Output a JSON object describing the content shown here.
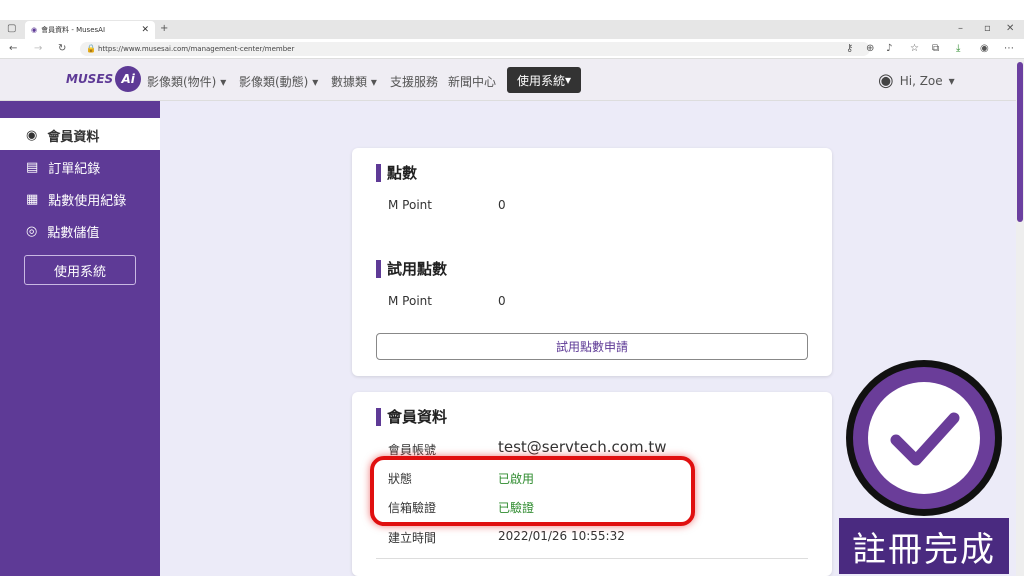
{
  "browser": {
    "tab_title": "會員資料 - MusesAI",
    "url": "https://www.musesai.com/management-center/member"
  },
  "nav": {
    "logo_text": "MUSES",
    "logo_badge": "Ai",
    "items": [
      "影像類(物件)",
      "影像類(動態)",
      "數據類",
      "支援服務",
      "新聞中心"
    ],
    "system_button": "使用系統",
    "user_greeting": "Hi, Zoe"
  },
  "sidebar": {
    "items": [
      "會員資料",
      "訂單紀錄",
      "點數使用紀錄",
      "點數儲值"
    ],
    "system_button": "使用系統"
  },
  "points": {
    "title": "點數",
    "label": "M Point",
    "value": "0"
  },
  "trial_points": {
    "title": "試用點數",
    "label": "M Point",
    "value": "0",
    "apply_button": "試用點數申請"
  },
  "member": {
    "title": "會員資料",
    "rows": [
      {
        "label": "會員帳號",
        "value": "test@servtech.com.tw"
      },
      {
        "label": "狀態",
        "value": "已啟用"
      },
      {
        "label": "信箱驗證",
        "value": "已驗證"
      },
      {
        "label": "建立時間",
        "value": "2022/01/26 10:55:32"
      }
    ]
  },
  "overlay": {
    "badge_caption": "註冊完成"
  },
  "colors": {
    "brand_purple": "#5e3a96",
    "status_green": "#2e8b2e",
    "highlight_red": "#e01010"
  }
}
